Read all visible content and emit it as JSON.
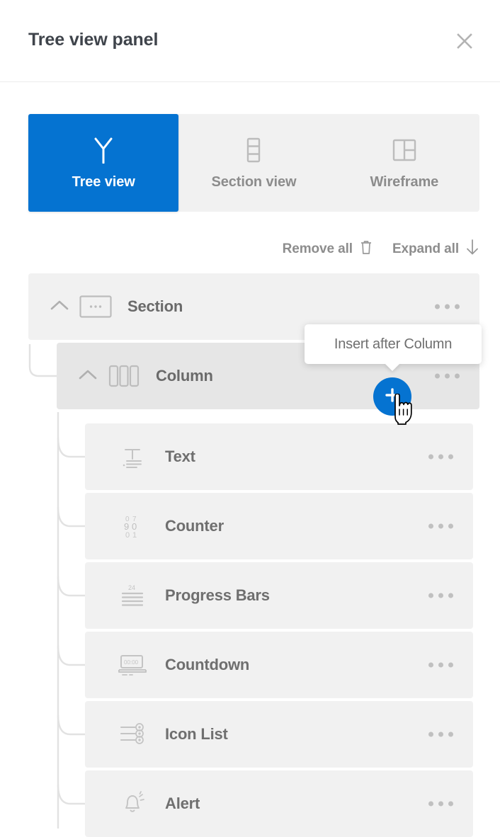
{
  "header": {
    "title": "Tree view panel",
    "close_icon": "close-icon"
  },
  "tabs": [
    {
      "label": "Tree view",
      "icon": "tree-branch-icon",
      "active": true
    },
    {
      "label": "Section view",
      "icon": "section-stack-icon",
      "active": false
    },
    {
      "label": "Wireframe",
      "icon": "wireframe-grid-icon",
      "active": false
    }
  ],
  "toolbar": {
    "remove_all_label": "Remove all",
    "remove_all_icon": "trash-icon",
    "expand_all_label": "Expand all",
    "expand_all_icon": "arrow-down-icon"
  },
  "tree": {
    "section": {
      "label": "Section",
      "icon": "section-placeholder-icon",
      "chevron": "chevron-up-icon",
      "menu_icon": "more-options-icon",
      "expanded": true
    },
    "column": {
      "label": "Column",
      "icon": "columns-icon",
      "chevron": "chevron-up-icon",
      "menu_icon": "more-options-icon",
      "expanded": true,
      "hovered": true
    },
    "children": [
      {
        "label": "Text",
        "icon": "text-icon",
        "menu_icon": "more-options-icon"
      },
      {
        "label": "Counter",
        "icon": "counter-digits-icon",
        "menu_icon": "more-options-icon"
      },
      {
        "label": "Progress Bars",
        "icon": "progress-bars-icon",
        "menu_icon": "more-options-icon"
      },
      {
        "label": "Countdown",
        "icon": "countdown-timer-icon",
        "menu_icon": "more-options-icon"
      },
      {
        "label": "Icon List",
        "icon": "icon-list-icon",
        "menu_icon": "more-options-icon"
      },
      {
        "label": "Alert",
        "icon": "alert-bell-icon",
        "menu_icon": "more-options-icon"
      }
    ]
  },
  "tooltip": {
    "text": "Insert after Column"
  },
  "insert_button": {
    "icon": "plus-icon"
  },
  "cursor": {
    "icon": "pointer-hand-cursor"
  },
  "colors": {
    "accent": "#0573d1",
    "row_bg": "#f1f1f1",
    "row_bg_hover": "#e6e6e6",
    "label": "#6f6f6f",
    "muted": "#8d8d8d",
    "title": "#3f444b"
  }
}
